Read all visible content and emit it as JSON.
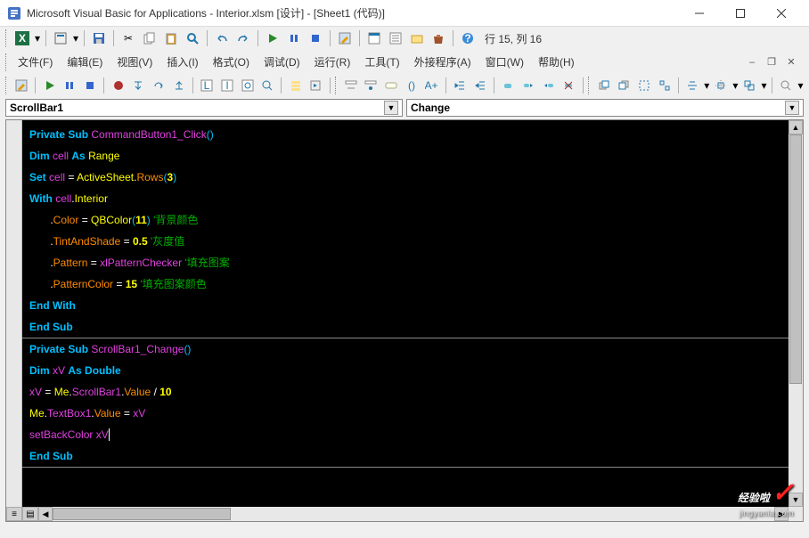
{
  "window": {
    "title": "Microsoft Visual Basic for Applications - Interior.xlsm [设计] - [Sheet1 (代码)]"
  },
  "cursor_status": "行 15, 列 16",
  "menus": {
    "file": "文件(F)",
    "edit": "编辑(E)",
    "view": "视图(V)",
    "insert": "插入(I)",
    "format": "格式(O)",
    "debug": "调试(D)",
    "run": "运行(R)",
    "tools": "工具(T)",
    "addins": "外接程序(A)",
    "window": "窗口(W)",
    "help": "帮助(H)"
  },
  "combos": {
    "object": "ScrollBar1",
    "procedure": "Change"
  },
  "code": {
    "lines": [
      {
        "t": [
          [
            "kw",
            "Private Sub"
          ],
          [
            "op",
            " "
          ],
          [
            "ident",
            "CommandButton1_Click"
          ],
          [
            "paren",
            "()"
          ]
        ]
      },
      {
        "t": [
          [
            "kw",
            "Dim"
          ],
          [
            "op",
            " "
          ],
          [
            "ident",
            "cell"
          ],
          [
            "op",
            " "
          ],
          [
            "kw",
            "As"
          ],
          [
            "op",
            " "
          ],
          [
            "cls",
            "Range"
          ]
        ]
      },
      {
        "t": [
          [
            "kw",
            "Set"
          ],
          [
            "op",
            " "
          ],
          [
            "ident",
            "cell"
          ],
          [
            "op",
            " = "
          ],
          [
            "cls",
            "ActiveSheet"
          ],
          [
            "op",
            "."
          ],
          [
            "prop",
            "Rows"
          ],
          [
            "paren",
            "("
          ],
          [
            "num",
            "3"
          ],
          [
            "paren",
            ")"
          ]
        ]
      },
      {
        "t": [
          [
            "kw",
            "With"
          ],
          [
            "op",
            " "
          ],
          [
            "ident",
            "cell"
          ],
          [
            "op",
            "."
          ],
          [
            "cls",
            "Interior"
          ]
        ]
      },
      {
        "t": [
          [
            "op",
            "       ."
          ],
          [
            "prop",
            "Color"
          ],
          [
            "op",
            " = "
          ],
          [
            "cls",
            "QBColor"
          ],
          [
            "paren",
            "("
          ],
          [
            "num",
            "11"
          ],
          [
            "paren",
            ")"
          ],
          [
            "op",
            " "
          ],
          [
            "cmt",
            "'背景颜色"
          ]
        ]
      },
      {
        "t": [
          [
            "op",
            "       ."
          ],
          [
            "prop",
            "TintAndShade"
          ],
          [
            "op",
            " = "
          ],
          [
            "num",
            "0.5"
          ],
          [
            "op",
            " "
          ],
          [
            "cmt",
            "'灰度值"
          ]
        ]
      },
      {
        "t": [
          [
            "op",
            "       ."
          ],
          [
            "prop",
            "Pattern"
          ],
          [
            "op",
            " = "
          ],
          [
            "ident",
            "xlPatternChecker"
          ],
          [
            "op",
            " "
          ],
          [
            "cmt",
            "'填充图案"
          ]
        ]
      },
      {
        "t": [
          [
            "op",
            "       ."
          ],
          [
            "prop",
            "PatternColor"
          ],
          [
            "op",
            " = "
          ],
          [
            "num",
            "15"
          ],
          [
            "op",
            " "
          ],
          [
            "cmt",
            "'填充图案颜色"
          ]
        ]
      },
      {
        "t": [
          [
            "kw",
            "End With"
          ]
        ]
      },
      {
        "t": [
          [
            "kw",
            "End Sub"
          ]
        ],
        "hr": true
      },
      {
        "t": [
          [
            "kw",
            "Private Sub"
          ],
          [
            "op",
            " "
          ],
          [
            "ident",
            "ScrollBar1_Change"
          ],
          [
            "paren",
            "()"
          ]
        ]
      },
      {
        "t": [
          [
            "kw",
            "Dim"
          ],
          [
            "op",
            " "
          ],
          [
            "ident",
            "xV"
          ],
          [
            "op",
            " "
          ],
          [
            "kw",
            "As Double"
          ]
        ]
      },
      {
        "t": [
          [
            "ident",
            "xV"
          ],
          [
            "op",
            " = "
          ],
          [
            "cls",
            "Me"
          ],
          [
            "op",
            "."
          ],
          [
            "ident",
            "ScrollBar1"
          ],
          [
            "op",
            "."
          ],
          [
            "prop",
            "Value"
          ],
          [
            "op",
            " / "
          ],
          [
            "num",
            "10"
          ]
        ]
      },
      {
        "t": [
          [
            "cls",
            "Me"
          ],
          [
            "op",
            "."
          ],
          [
            "ident",
            "TextBox1"
          ],
          [
            "op",
            "."
          ],
          [
            "prop",
            "Value"
          ],
          [
            "op",
            " = "
          ],
          [
            "ident",
            "xV"
          ]
        ]
      },
      {
        "t": [
          [
            "ident",
            "setBackColor xV"
          ]
        ],
        "cursor": true
      },
      {
        "t": [
          [
            "kw",
            "End Sub"
          ]
        ],
        "hr": true
      }
    ]
  },
  "watermark": {
    "main": "经验啦",
    "url": "jingyanla.com"
  }
}
